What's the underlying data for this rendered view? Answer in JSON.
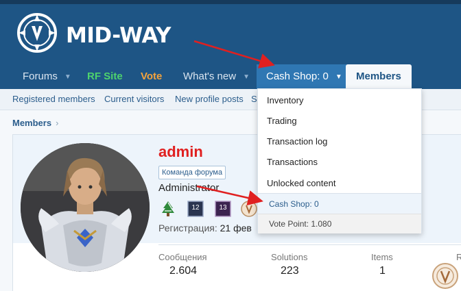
{
  "logo": {
    "text": "MID-WAY"
  },
  "nav": {
    "forums": "Forums",
    "rf_site": "RF Site",
    "vote": "Vote",
    "whats_new": "What's new",
    "cash_shop": "Cash Shop: 0",
    "members": "Members"
  },
  "subnav": {
    "registered": "Registered members",
    "current": "Current visitors",
    "new_posts": "New profile posts",
    "cut": "S"
  },
  "breadcrumb": {
    "members": "Members",
    "sep": "›"
  },
  "dropdown": {
    "items": [
      "Inventory",
      "Trading",
      "Transaction log",
      "Transactions",
      "Unlocked content"
    ],
    "cash_shop": "Cash Shop: 0",
    "vote_point": "Vote Point: 1.080"
  },
  "profile": {
    "username": "admin",
    "badge": "Команда форума",
    "role": "Administrator",
    "registration_label": "Регистрация:",
    "registration_value": "21 фев",
    "stats": [
      {
        "label": "Сообщения",
        "value": "2.604"
      },
      {
        "label": "Solutions",
        "value": "223"
      },
      {
        "label": "Items",
        "value": "1"
      },
      {
        "label": "R",
        "value": ""
      }
    ],
    "trophies": [
      {
        "icon": "tree-icon",
        "text": ""
      },
      {
        "icon": "level-badge-icon",
        "text": "12"
      },
      {
        "icon": "level-badge-icon",
        "text": "13"
      },
      {
        "icon": "seal-icon",
        "text": ""
      }
    ]
  },
  "colors": {
    "header": "#1e5585",
    "active_tab": "#2f77b3",
    "rf_site": "#4ed36d",
    "vote": "#f5a33c",
    "username": "#e02020",
    "arrow": "#e02020"
  }
}
